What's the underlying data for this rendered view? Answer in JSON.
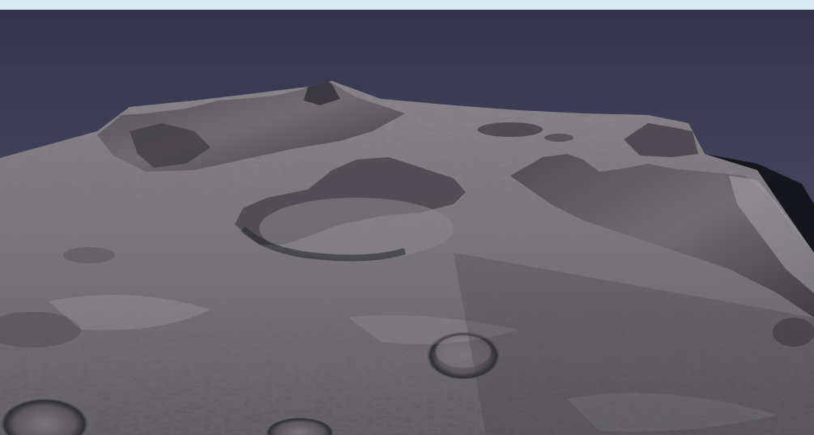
{
  "scene": {
    "subject": "terrain",
    "colors": {
      "top_strip": "#d9ecf5",
      "sky_top": "#36364a",
      "sky_bottom": "#555570",
      "terrain_base": "#6f6b70",
      "terrain_light": "#9c989c",
      "terrain_dark": "#2f2e34",
      "shadow": "#121218"
    }
  }
}
